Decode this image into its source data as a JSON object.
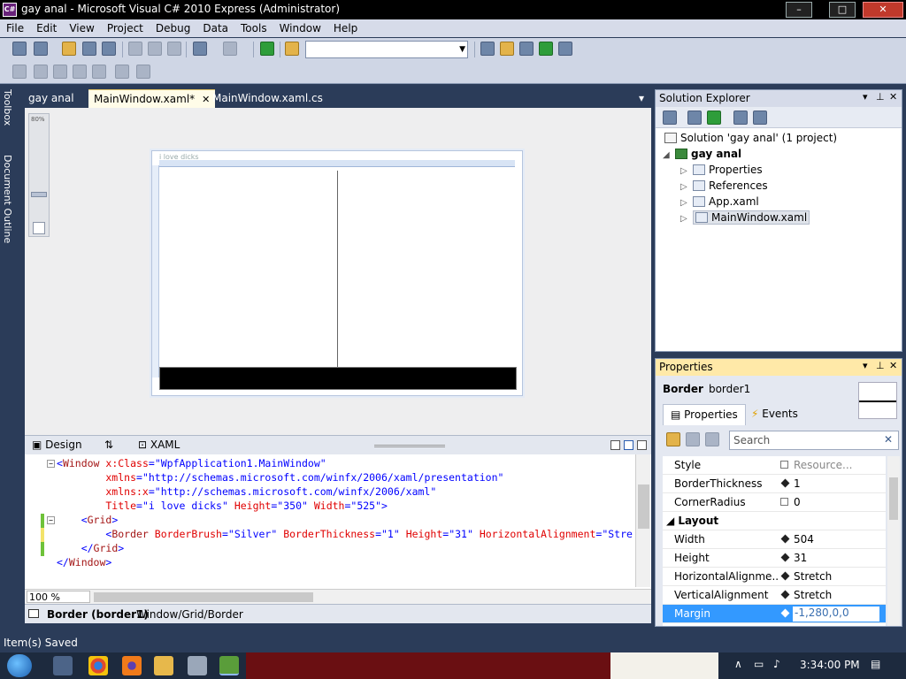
{
  "window": {
    "title": "gay anal - Microsoft Visual C# 2010 Express (Administrator)",
    "min_label": "–",
    "max_label": "□",
    "close_label": "✕"
  },
  "menu": [
    "File",
    "Edit",
    "View",
    "Project",
    "Debug",
    "Data",
    "Tools",
    "Window",
    "Help"
  ],
  "side_tabs": {
    "toolbox": "Toolbox",
    "document_outline": "Document Outline"
  },
  "doc_tabs": [
    {
      "label": "gay anal"
    },
    {
      "label": "MainWindow.xaml*",
      "active": true
    },
    {
      "label": "MainWindow.xaml.cs"
    }
  ],
  "designer": {
    "zoom_slider_label": "80%",
    "window_caption": "i love dicks"
  },
  "split": {
    "design_label": "Design",
    "swap_label": "⇅",
    "xaml_label": "XAML"
  },
  "xaml_lines": [
    {
      "parts": [
        [
          "p",
          "<"
        ],
        [
          "k",
          "Window"
        ],
        [
          "a",
          " x:Class"
        ],
        [
          "p",
          "="
        ],
        [
          "v",
          "\"WpfApplication1.MainWindow\""
        ]
      ]
    },
    {
      "parts": [
        [
          "a",
          "        xmlns"
        ],
        [
          "p",
          "="
        ],
        [
          "v",
          "\"http://schemas.microsoft.com/winfx/2006/xaml/presentation\""
        ]
      ]
    },
    {
      "parts": [
        [
          "a",
          "        xmlns:x"
        ],
        [
          "p",
          "="
        ],
        [
          "v",
          "\"http://schemas.microsoft.com/winfx/2006/xaml\""
        ]
      ]
    },
    {
      "parts": [
        [
          "a",
          "        Title"
        ],
        [
          "p",
          "="
        ],
        [
          "v",
          "\"i love dicks\""
        ],
        [
          "a",
          " Height"
        ],
        [
          "p",
          "="
        ],
        [
          "v",
          "\"350\""
        ],
        [
          "a",
          " Width"
        ],
        [
          "p",
          "="
        ],
        [
          "v",
          "\"525\""
        ],
        [
          "p",
          ">"
        ]
      ]
    },
    {
      "parts": [
        [
          "p",
          "    <"
        ],
        [
          "k",
          "Grid"
        ],
        [
          "p",
          ">"
        ]
      ]
    },
    {
      "parts": [
        [
          "p",
          "        <"
        ],
        [
          "k",
          "Border"
        ],
        [
          "a",
          " BorderBrush"
        ],
        [
          "p",
          "="
        ],
        [
          "v",
          "\"Silver\""
        ],
        [
          "a",
          " BorderThickness"
        ],
        [
          "p",
          "="
        ],
        [
          "v",
          "\"1\""
        ],
        [
          "a",
          " Height"
        ],
        [
          "p",
          "="
        ],
        [
          "v",
          "\"31\""
        ],
        [
          "a",
          " HorizontalAlignment"
        ],
        [
          "p",
          "="
        ],
        [
          "v",
          "\"Stre"
        ]
      ]
    },
    {
      "parts": [
        [
          "p",
          "    </"
        ],
        [
          "k",
          "Grid"
        ],
        [
          "p",
          ">"
        ]
      ]
    },
    {
      "parts": [
        [
          "p",
          "</"
        ],
        [
          "k",
          "Window"
        ],
        [
          "p",
          ">"
        ]
      ]
    }
  ],
  "editor": {
    "zoom": "100 %"
  },
  "breadcrumb": {
    "element": "Border (border1)",
    "path": "Window/Grid/Border"
  },
  "solution_explorer": {
    "title": "Solution Explorer",
    "nodes": [
      {
        "label": "Solution 'gay anal' (1 project)"
      },
      {
        "label": "gay anal"
      },
      {
        "label": "Properties"
      },
      {
        "label": "References"
      },
      {
        "label": "App.xaml"
      },
      {
        "label": "MainWindow.xaml"
      }
    ]
  },
  "properties": {
    "title": "Properties",
    "object_type": "Border",
    "object_name": "border1",
    "tab_properties": "Properties",
    "tab_events": "Events",
    "search_placeholder": "Search",
    "rows": [
      {
        "name": "Style",
        "value": "Resource..."
      },
      {
        "name": "BorderThickness",
        "value": "1"
      },
      {
        "name": "CornerRadius",
        "value": "0"
      },
      {
        "name": "Layout",
        "value": ""
      },
      {
        "name": "Width",
        "value": "504"
      },
      {
        "name": "Height",
        "value": "31"
      },
      {
        "name": "HorizontalAlignme...",
        "value": "Stretch"
      },
      {
        "name": "VerticalAlignment",
        "value": "Stretch"
      },
      {
        "name": "Margin",
        "value": "-1,280,0,0"
      }
    ]
  },
  "status": {
    "text": "Item(s) Saved"
  },
  "taskbar": {
    "clock": "3:34:00 PM"
  },
  "colors": {
    "chrome": "#2b3c59",
    "accent_tab": "#fffce8",
    "selection": "#3399ff"
  }
}
